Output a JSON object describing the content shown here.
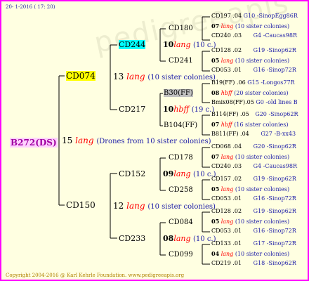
{
  "header_date": "20-  1-2016 ( 17: 20)",
  "footer": "Copyright 2004-2016 @ Karl Kehrle Foundation.   www.pedigreeapis.org",
  "watermark": "pedigreeapis",
  "root": {
    "id": "B272(DS)",
    "num": "15",
    "lang": "lang",
    "note": "(Drones from 10 sister colonies)"
  },
  "g1": [
    {
      "id": "CD074",
      "num": "13",
      "lang": "lang",
      "note": "(10 sister colonies)"
    },
    {
      "id": "CD150",
      "num": "12",
      "lang": "lang",
      "note": "(10 sister colonies)"
    }
  ],
  "g2": [
    {
      "id": "CD244",
      "num": "10",
      "lang": "lang",
      "note": "(10 c.)"
    },
    {
      "id": "CD217",
      "num": "10",
      "lang": "hbff",
      "note": "(19 c.)"
    },
    {
      "id": "CD152",
      "num": "09",
      "lang": "lang",
      "note": "(10 c.)"
    },
    {
      "id": "CD233",
      "num": "08",
      "lang": "lang",
      "note": "(10 c.)"
    }
  ],
  "g3": [
    {
      "id": "CD180"
    },
    {
      "id": "CD241"
    },
    {
      "id": "B30(FF)"
    },
    {
      "id": "B104(FF)"
    },
    {
      "id": "CD178"
    },
    {
      "id": "CD258"
    },
    {
      "id": "CD084"
    },
    {
      "id": "CD099"
    }
  ],
  "g4": [
    {
      "a": "CD197",
      "b": ".04",
      "c": "G10 -SinopEgg86R",
      "n": "07",
      "l": "lang",
      "s": "(10 sister colonies)",
      "d": "CD240",
      "e": ".03",
      "f": "G4 -Caucas98R"
    },
    {
      "a": "CD128",
      "b": ".02",
      "c": "G19 -Sinop62R",
      "n": "05",
      "l": "lang",
      "s": "(10 sister colonies)",
      "d": "CD053",
      "e": ".01",
      "f": "G16 -Sinop72R"
    },
    {
      "a": "B19(FF)",
      "b": ".06",
      "c": "G15 -Longos77R",
      "n": "08",
      "l": "hbff",
      "s": "(20 sister colonies)",
      "d": "Bmix08(FF)",
      "e": ".05",
      "f": "G0 -old lines B"
    },
    {
      "a": "B114(FF)",
      "b": ".05",
      "c": "G20 -Sinop62R",
      "n": "07",
      "l": "hbff",
      "s": "(16 sister colonies)",
      "d": "B811(FF)",
      "e": ".04",
      "f": "G27 -B-xx43"
    },
    {
      "a": "CD068",
      "b": ".04",
      "c": "G20 -Sinop62R",
      "n": "07",
      "l": "lang",
      "s": "(10 sister colonies)",
      "d": "CD240",
      "e": ".03",
      "f": "G4 -Caucas98R"
    },
    {
      "a": "CD157",
      "b": ".02",
      "c": "G19 -Sinop62R",
      "n": "05",
      "l": "lang",
      "s": "(10 sister colonies)",
      "d": "CD053",
      "e": ".01",
      "f": "G16 -Sinop72R"
    },
    {
      "a": "CD128",
      "b": ".02",
      "c": "G19 -Sinop62R",
      "n": "05",
      "l": "lang",
      "s": "(10 sister colonies)",
      "d": "CD053",
      "e": ".01",
      "f": "G16 -Sinop72R"
    },
    {
      "a": "CD133",
      "b": ".01",
      "c": "G17 -Sinop72R",
      "n": "04",
      "l": "lang",
      "s": "(10 sister colonies)",
      "d": "CD219",
      "e": ".01",
      "f": "G18 -Sinop62R"
    }
  ]
}
